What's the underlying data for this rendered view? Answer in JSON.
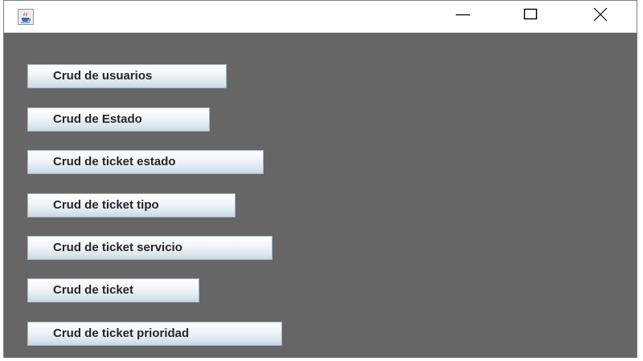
{
  "window": {
    "title": "",
    "app_icon": "java-cup-icon",
    "controls": {
      "minimize": "minimize-icon",
      "maximize": "maximize-icon",
      "close": "close-icon"
    }
  },
  "menu": {
    "buttons": [
      {
        "label": "Crud de usuarios"
      },
      {
        "label": "Crud de Estado"
      },
      {
        "label": "Crud de ticket estado"
      },
      {
        "label": "Crud de ticket tipo"
      },
      {
        "label": "Crud de ticket servicio"
      },
      {
        "label": "Crud de ticket"
      },
      {
        "label": "Crud de ticket prioridad"
      }
    ]
  },
  "colors": {
    "content_background": "#666666",
    "button_border": "#a8b8c8",
    "button_text": "#262626"
  }
}
